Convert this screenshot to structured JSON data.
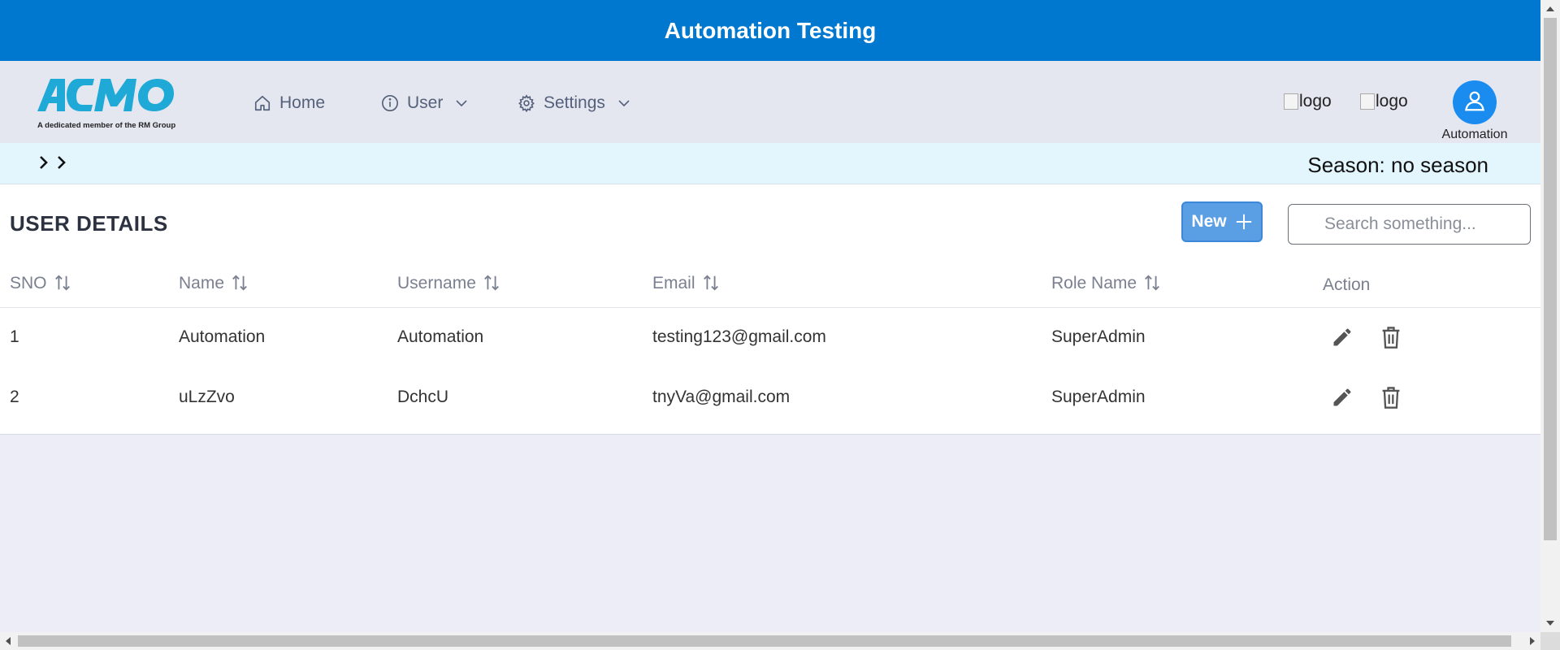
{
  "app": {
    "title": "Automation Testing"
  },
  "brand": {
    "logo_text": "ACMO",
    "tagline": "A dedicated member of the RM Group"
  },
  "nav": {
    "items": [
      {
        "label": "Home",
        "icon": "home-icon"
      },
      {
        "label": "User",
        "icon": "info-icon",
        "has_dropdown": true
      },
      {
        "label": "Settings",
        "icon": "gear-icon",
        "has_dropdown": true
      }
    ]
  },
  "header_right": {
    "logo1_alt": "logo",
    "logo2_alt": "logo",
    "user_name": "Automation"
  },
  "season_bar": {
    "season_label": "Season: no season"
  },
  "panel": {
    "title": "USER DETAILS",
    "new_label": "New",
    "search_placeholder": "Search something..."
  },
  "table": {
    "columns": [
      "SNO",
      "Name",
      "Username",
      "Email",
      "Role Name",
      "Action"
    ],
    "rows": [
      {
        "sno": "1",
        "name": "Automation",
        "username": "Automation",
        "email": "testing123@gmail.com",
        "role": "SuperAdmin"
      },
      {
        "sno": "2",
        "name": "uLzZvo",
        "username": "DchcU",
        "email": "tnyVa@gmail.com",
        "role": "SuperAdmin"
      }
    ]
  },
  "colors": {
    "topbar": "#0078d0",
    "navbar": "#e4e7f0",
    "season_bar": "#e3f5fd",
    "new_button": "#5a9ee4",
    "avatar": "#1a8cf0",
    "brand": "#1fa9d6"
  }
}
